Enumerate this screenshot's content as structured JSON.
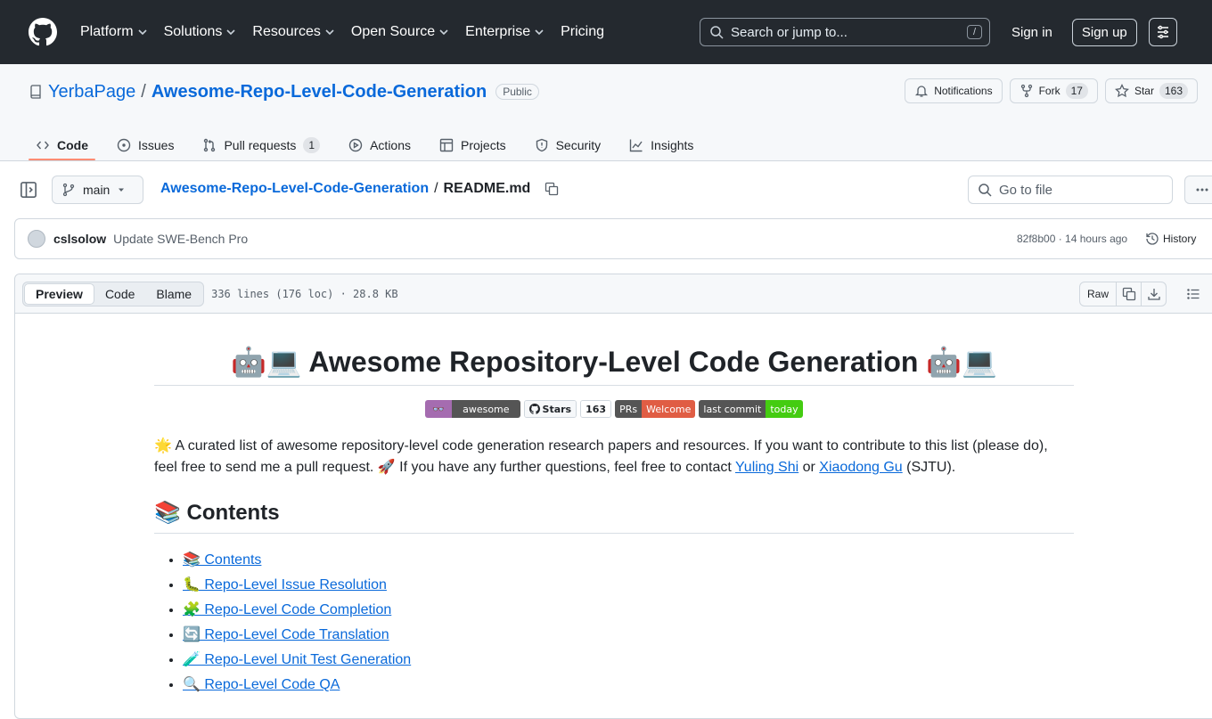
{
  "nav": {
    "items": [
      "Platform",
      "Solutions",
      "Resources",
      "Open Source",
      "Enterprise",
      "Pricing"
    ],
    "search_placeholder": "Search or jump to...",
    "search_key": "/",
    "signin": "Sign in",
    "signup": "Sign up"
  },
  "repo": {
    "owner": "YerbaPage",
    "separator": "/",
    "name": "Awesome-Repo-Level-Code-Generation",
    "visibility": "Public",
    "notifications": "Notifications",
    "fork_label": "Fork",
    "fork_count": "17",
    "star_label": "Star",
    "star_count": "163"
  },
  "tabs": [
    {
      "label": "Code",
      "icon": "code-icon"
    },
    {
      "label": "Issues",
      "icon": "issue-icon"
    },
    {
      "label": "Pull requests",
      "icon": "pull-request-icon",
      "count": "1"
    },
    {
      "label": "Actions",
      "icon": "play-icon"
    },
    {
      "label": "Projects",
      "icon": "table-icon"
    },
    {
      "label": "Security",
      "icon": "shield-icon"
    },
    {
      "label": "Insights",
      "icon": "graph-icon"
    }
  ],
  "file": {
    "branch": "main",
    "repo_link": "Awesome-Repo-Level-Code-Generation",
    "separator": "/",
    "filename": "README.md",
    "go_to_file": "Go to file"
  },
  "commit": {
    "author": "cslsolow",
    "message": "Update SWE-Bench Pro",
    "meta": "82f8b00 · 14 hours ago",
    "history": "History"
  },
  "viewer": {
    "modes": [
      "Preview",
      "Code",
      "Blame"
    ],
    "info": "336 lines (176 loc) · 28.8 KB",
    "raw": "Raw"
  },
  "readme": {
    "title": "🤖💻 Awesome Repository-Level Code Generation 🤖💻",
    "badges": [
      {
        "left": "👓",
        "right": "awesome",
        "left_color": "#a56cb0",
        "right_color": "#555555"
      },
      {
        "left": "Stars",
        "right": "163",
        "left_color": "#555555",
        "right_color": "#ffffff"
      },
      {
        "left": "PRs",
        "right": "Welcome",
        "left_color": "#555555",
        "right_color": "#e05d44"
      },
      {
        "left": "last commit",
        "right": "today",
        "left_color": "#555555",
        "right_color": "#4c1"
      }
    ],
    "intro_1": "🌟 A curated list of awesome repository-level code generation research papers and resources. If you want to contribute to this list (please do), feel free to send me a pull request. 🚀 If you have any further questions, feel free to contact ",
    "contact_1": "Yuling Shi",
    "intro_or": " or ",
    "contact_2": "Xiaodong Gu",
    "intro_end": " (SJTU).",
    "contents_heading": "📚 Contents",
    "toc": [
      "📚 Contents",
      "🐛 Repo-Level Issue Resolution",
      "🧩 Repo-Level Code Completion",
      "🔄 Repo-Level Code Translation",
      "🧪 Repo-Level Unit Test Generation",
      "🔍 Repo-Level Code QA"
    ]
  }
}
